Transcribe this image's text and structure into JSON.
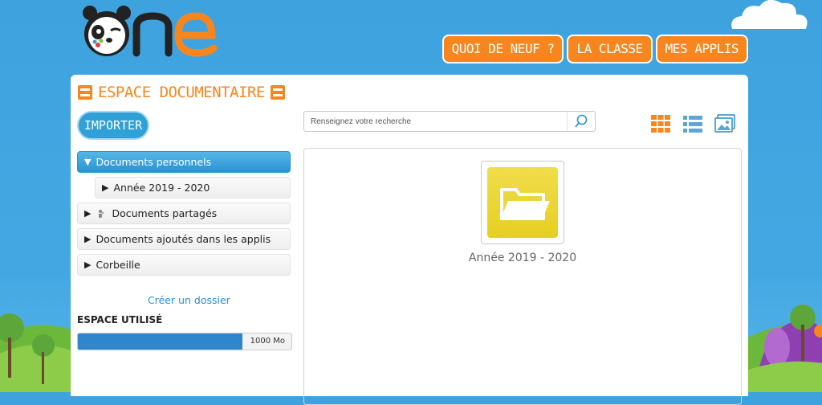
{
  "nav": {
    "items": [
      {
        "label": "QUOI DE NEUF ?"
      },
      {
        "label": "LA CLASSE"
      },
      {
        "label": "MES APPLIS"
      }
    ]
  },
  "page": {
    "title": "ESPACE DOCUMENTAIRE"
  },
  "toolbar": {
    "import_label": "IMPORTER"
  },
  "tree": {
    "items": [
      {
        "label": "Documents personnels",
        "arrow": "▼"
      },
      {
        "label": "Année 2019 - 2020",
        "arrow": "▶"
      },
      {
        "label": "Documents partagés",
        "arrow": "▶"
      },
      {
        "label": "Documents ajoutés dans les applis",
        "arrow": "▶"
      },
      {
        "label": "Corbeille",
        "arrow": "▶"
      }
    ]
  },
  "create_folder_label": "Créer un dossier",
  "storage": {
    "label": "ESPACE UTILISÉ",
    "total": "1000 Mo",
    "used_fraction": 0.77
  },
  "search": {
    "placeholder": "Renseignez votre recherche",
    "value": ""
  },
  "view_icons": [
    "grid-view-icon",
    "list-view-icon",
    "image-view-icon"
  ],
  "content": {
    "folders": [
      {
        "name": "Année 2019 - 2020"
      }
    ]
  },
  "colors": {
    "accent": "#f7861e",
    "primary": "#2a92d0",
    "folder": "#e9d22e"
  }
}
